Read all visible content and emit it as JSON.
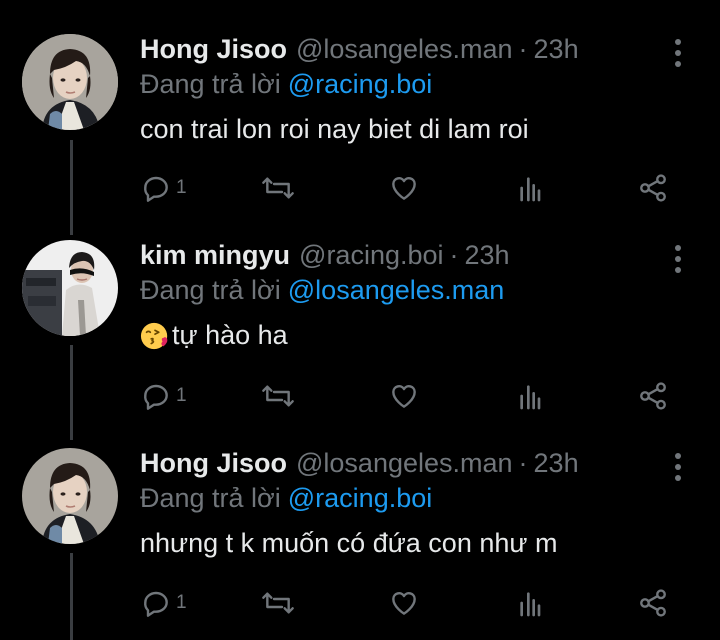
{
  "colors": {
    "background": "#000000",
    "primary_text": "#e7e9ea",
    "secondary_text": "#71767b",
    "mention": "#1d9bf0",
    "thread_line": "#3a3d41"
  },
  "tweets": [
    {
      "display_name": "Hong Jisoo",
      "handle": "@losangeles.man",
      "separator": "·",
      "time": "23h",
      "reply_prefix": "Đang trả lời",
      "reply_to": "@racing.boi",
      "emoji": "",
      "text": "con trai lon roi nay biet di lam roi",
      "reply_count": "1",
      "avatar": "avatar-hong-jisoo"
    },
    {
      "display_name": "kim mingyu",
      "handle": "@racing.boi",
      "separator": "·",
      "time": "23h",
      "reply_prefix": "Đang trả lời",
      "reply_to": "@losangeles.man",
      "emoji": "face-blowing-a-kiss",
      "text": "tự hào ha",
      "reply_count": "1",
      "avatar": "avatar-kim-mingyu"
    },
    {
      "display_name": "Hong Jisoo",
      "handle": "@losangeles.man",
      "separator": "·",
      "time": "23h",
      "reply_prefix": "Đang trả lời",
      "reply_to": "@racing.boi",
      "emoji": "",
      "text": "nhưng t k muốn có đứa con như m",
      "reply_count": "1",
      "avatar": "avatar-hong-jisoo"
    }
  ],
  "action_icons": [
    "reply-icon",
    "retweet-icon",
    "like-icon",
    "analytics-icon",
    "share-icon"
  ],
  "more_icon": "more-vertical-icon"
}
